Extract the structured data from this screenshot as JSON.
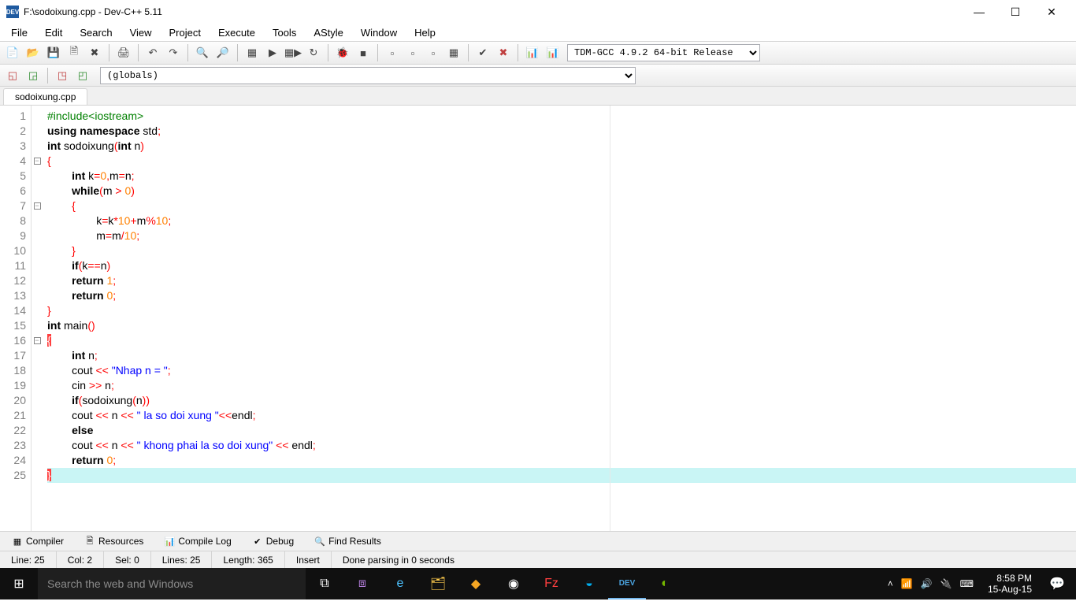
{
  "window": {
    "title": "F:\\sodoixung.cpp - Dev-C++ 5.11"
  },
  "menu": [
    "File",
    "Edit",
    "Search",
    "View",
    "Project",
    "Execute",
    "Tools",
    "AStyle",
    "Window",
    "Help"
  ],
  "compiler_select": "TDM-GCC 4.9.2 64-bit Release",
  "scope_select": "(globals)",
  "tab": "sodoixung.cpp",
  "code_lines": [
    {
      "n": 1,
      "fold": "",
      "tokens": [
        [
          "pre",
          "#include<iostream>"
        ]
      ]
    },
    {
      "n": 2,
      "fold": "",
      "tokens": [
        [
          "kw",
          "using"
        ],
        [
          "txt",
          " "
        ],
        [
          "kw",
          "namespace"
        ],
        [
          "txt",
          " std"
        ],
        [
          "op",
          ";"
        ]
      ]
    },
    {
      "n": 3,
      "fold": "",
      "tokens": [
        [
          "kw",
          "int"
        ],
        [
          "txt",
          " sodoixung"
        ],
        [
          "op",
          "("
        ],
        [
          "kw",
          "int"
        ],
        [
          "txt",
          " n"
        ],
        [
          "op",
          ")"
        ]
      ]
    },
    {
      "n": 4,
      "fold": "box",
      "tokens": [
        [
          "op",
          "{"
        ]
      ]
    },
    {
      "n": 5,
      "fold": "",
      "tokens": [
        [
          "txt",
          "        "
        ],
        [
          "kw",
          "int"
        ],
        [
          "txt",
          " k"
        ],
        [
          "op",
          "="
        ],
        [
          "num",
          "0"
        ],
        [
          "op",
          ","
        ],
        [
          "txt",
          "m"
        ],
        [
          "op",
          "="
        ],
        [
          "txt",
          "n"
        ],
        [
          "op",
          ";"
        ]
      ]
    },
    {
      "n": 6,
      "fold": "",
      "tokens": [
        [
          "txt",
          "        "
        ],
        [
          "kw",
          "while"
        ],
        [
          "op",
          "("
        ],
        [
          "txt",
          "m "
        ],
        [
          "op",
          ">"
        ],
        [
          "txt",
          " "
        ],
        [
          "num",
          "0"
        ],
        [
          "op",
          ")"
        ]
      ]
    },
    {
      "n": 7,
      "fold": "box",
      "tokens": [
        [
          "txt",
          "        "
        ],
        [
          "op",
          "{"
        ]
      ]
    },
    {
      "n": 8,
      "fold": "",
      "tokens": [
        [
          "txt",
          "                k"
        ],
        [
          "op",
          "="
        ],
        [
          "txt",
          "k"
        ],
        [
          "op",
          "*"
        ],
        [
          "num",
          "10"
        ],
        [
          "op",
          "+"
        ],
        [
          "txt",
          "m"
        ],
        [
          "op",
          "%"
        ],
        [
          "num",
          "10"
        ],
        [
          "op",
          ";"
        ]
      ]
    },
    {
      "n": 9,
      "fold": "",
      "tokens": [
        [
          "txt",
          "                m"
        ],
        [
          "op",
          "="
        ],
        [
          "txt",
          "m"
        ],
        [
          "op",
          "/"
        ],
        [
          "num",
          "10"
        ],
        [
          "op",
          ";"
        ]
      ]
    },
    {
      "n": 10,
      "fold": "",
      "tokens": [
        [
          "txt",
          "        "
        ],
        [
          "op",
          "}"
        ]
      ]
    },
    {
      "n": 11,
      "fold": "",
      "tokens": [
        [
          "txt",
          "        "
        ],
        [
          "kw",
          "if"
        ],
        [
          "op",
          "("
        ],
        [
          "txt",
          "k"
        ],
        [
          "op",
          "=="
        ],
        [
          "txt",
          "n"
        ],
        [
          "op",
          ")"
        ]
      ]
    },
    {
      "n": 12,
      "fold": "",
      "tokens": [
        [
          "txt",
          "        "
        ],
        [
          "kw",
          "return"
        ],
        [
          "txt",
          " "
        ],
        [
          "num",
          "1"
        ],
        [
          "op",
          ";"
        ]
      ]
    },
    {
      "n": 13,
      "fold": "",
      "tokens": [
        [
          "txt",
          "        "
        ],
        [
          "kw",
          "return"
        ],
        [
          "txt",
          " "
        ],
        [
          "num",
          "0"
        ],
        [
          "op",
          ";"
        ]
      ]
    },
    {
      "n": 14,
      "fold": "",
      "tokens": [
        [
          "op",
          "}"
        ]
      ]
    },
    {
      "n": 15,
      "fold": "",
      "tokens": [
        [
          "kw",
          "int"
        ],
        [
          "txt",
          " main"
        ],
        [
          "op",
          "()"
        ]
      ]
    },
    {
      "n": 16,
      "fold": "box",
      "tokens": [
        [
          "bracehl",
          "{"
        ]
      ]
    },
    {
      "n": 17,
      "fold": "",
      "tokens": [
        [
          "txt",
          "        "
        ],
        [
          "kw",
          "int"
        ],
        [
          "txt",
          " n"
        ],
        [
          "op",
          ";"
        ]
      ]
    },
    {
      "n": 18,
      "fold": "",
      "tokens": [
        [
          "txt",
          "        cout "
        ],
        [
          "op",
          "<<"
        ],
        [
          "txt",
          " "
        ],
        [
          "str",
          "\"Nhap n = \""
        ],
        [
          "op",
          ";"
        ]
      ]
    },
    {
      "n": 19,
      "fold": "",
      "tokens": [
        [
          "txt",
          "        cin "
        ],
        [
          "op",
          ">>"
        ],
        [
          "txt",
          " n"
        ],
        [
          "op",
          ";"
        ]
      ]
    },
    {
      "n": 20,
      "fold": "",
      "tokens": [
        [
          "txt",
          "        "
        ],
        [
          "kw",
          "if"
        ],
        [
          "op",
          "("
        ],
        [
          "txt",
          "sodoixung"
        ],
        [
          "op",
          "("
        ],
        [
          "txt",
          "n"
        ],
        [
          "op",
          "))"
        ]
      ]
    },
    {
      "n": 21,
      "fold": "",
      "tokens": [
        [
          "txt",
          "        cout "
        ],
        [
          "op",
          "<<"
        ],
        [
          "txt",
          " n "
        ],
        [
          "op",
          "<<"
        ],
        [
          "txt",
          " "
        ],
        [
          "str",
          "\" la so doi xung \""
        ],
        [
          "op",
          "<<"
        ],
        [
          "txt",
          "endl"
        ],
        [
          "op",
          ";"
        ]
      ]
    },
    {
      "n": 22,
      "fold": "",
      "tokens": [
        [
          "txt",
          "        "
        ],
        [
          "kw",
          "else"
        ]
      ]
    },
    {
      "n": 23,
      "fold": "",
      "tokens": [
        [
          "txt",
          "        cout "
        ],
        [
          "op",
          "<<"
        ],
        [
          "txt",
          " n "
        ],
        [
          "op",
          "<<"
        ],
        [
          "txt",
          " "
        ],
        [
          "str",
          "\" khong phai la so doi xung\""
        ],
        [
          "txt",
          " "
        ],
        [
          "op",
          "<<"
        ],
        [
          "txt",
          " endl"
        ],
        [
          "op",
          ";"
        ]
      ]
    },
    {
      "n": 24,
      "fold": "",
      "tokens": [
        [
          "txt",
          "        "
        ],
        [
          "kw",
          "return"
        ],
        [
          "txt",
          " "
        ],
        [
          "num",
          "0"
        ],
        [
          "op",
          ";"
        ]
      ]
    },
    {
      "n": 25,
      "fold": "",
      "hl": true,
      "tokens": [
        [
          "bracehl",
          "}"
        ]
      ]
    }
  ],
  "bottom_tabs": [
    "Compiler",
    "Resources",
    "Compile Log",
    "Debug",
    "Find Results"
  ],
  "status": {
    "line": "Line:   25",
    "col": "Col:   2",
    "sel": "Sel:   0",
    "lines": "Lines:   25",
    "length": "Length:   365",
    "mode": "Insert",
    "msg": "Done parsing in 0 seconds"
  },
  "taskbar": {
    "search_placeholder": "Search the web and Windows",
    "time": "8:58 PM",
    "date": "15-Aug-15"
  }
}
